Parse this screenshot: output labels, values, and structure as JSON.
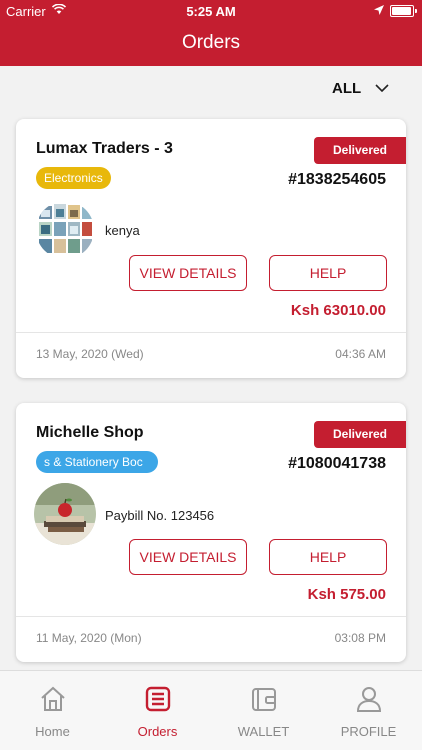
{
  "status_bar": {
    "carrier": "Carrier",
    "time": "5:25 AM"
  },
  "header": {
    "title": "Orders"
  },
  "filter": {
    "label": "ALL"
  },
  "orders": [
    {
      "shop": "Lumax Traders - 3",
      "status": "Delivered",
      "category": "Electronics",
      "order_number": "#1838254605",
      "location": "kenya",
      "view_label": "VIEW DETAILS",
      "help_label": "HELP",
      "amount": "Ksh 63010.00",
      "date": "13 May, 2020 (Wed)",
      "time": "04:36 AM"
    },
    {
      "shop": "Michelle Shop",
      "status": "Delivered",
      "category": "s & Stationery  Boc",
      "order_number": "#1080041738",
      "location": "Paybill No. 123456",
      "view_label": "VIEW DETAILS",
      "help_label": "HELP",
      "amount": "Ksh 575.00",
      "date": "11 May, 2020 (Mon)",
      "time": "03:08 PM"
    }
  ],
  "tabbar": {
    "tabs": [
      {
        "label": "Home",
        "icon": "home-icon"
      },
      {
        "label": "Orders",
        "icon": "orders-icon"
      },
      {
        "label": "WALLET",
        "icon": "wallet-icon"
      },
      {
        "label": "PROFILE",
        "icon": "profile-icon"
      }
    ]
  },
  "colors": {
    "brand": "#c41e30",
    "tag_electronics": "#e8b80b",
    "tag_stationery": "#3ca6e7"
  }
}
